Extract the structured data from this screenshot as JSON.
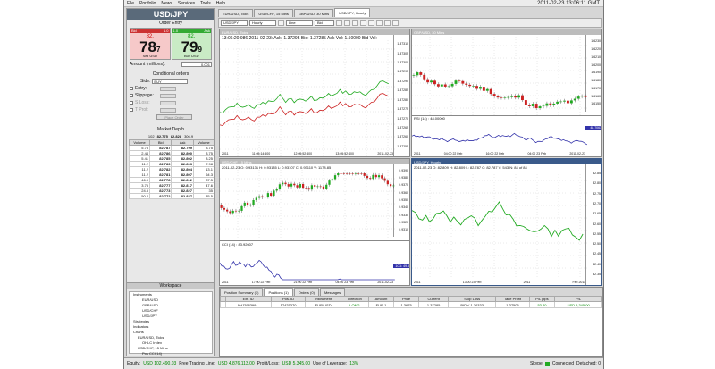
{
  "menu": [
    "File",
    "Portfolio",
    "News",
    "Services",
    "Tools",
    "Help"
  ],
  "clock": "2011-02-23 13:06:11 GMT",
  "order": {
    "symbol": "USD/JPY",
    "subtitle": "Order Entry",
    "bid_label": "Bid",
    "ask_label": "Ask",
    "bid_spread": "1.0",
    "ask_spread": "1.0",
    "bid_small": "82.",
    "ask_small": "82.",
    "bid_big": "78",
    "bid_pip": "7",
    "ask_big": "79",
    "ask_pip": "9",
    "sell_label": "Sell USD",
    "buy_label": "Buy USD",
    "amount_label": "Amount (millions):",
    "amount": "0.001",
    "cond_title": "Conditional orders",
    "side_label": "Side:",
    "side": "BUY",
    "entry": "Entry:",
    "slippage": "Slippage:",
    "sl": "S Loss:",
    "tp": "T Prof:",
    "submit": "Place Order"
  },
  "depth": {
    "title": "Market Depth",
    "summary_left": "102",
    "summary_mid": "82.775",
    "summary_right": "82.828",
    "summary_end": "306.9",
    "headers": [
      "Volume",
      "Bid",
      "Ask",
      "Volume"
    ],
    "rows": [
      [
        "5.75",
        "82.787",
        "82.799",
        "3.75"
      ],
      [
        "2.44",
        "82.786",
        "82.800",
        "3.75"
      ],
      [
        "5.41",
        "82.785",
        "82.802",
        "8.25"
      ],
      [
        "11.2",
        "82.783",
        "82.803",
        "7.98"
      ],
      [
        "11.2",
        "82.782",
        "82.804",
        "13.1"
      ],
      [
        "11.2",
        "82.781",
        "82.807",
        "64.3"
      ],
      [
        "46.9",
        "82.778",
        "82.812",
        "37.5"
      ],
      [
        "3.75",
        "82.777",
        "82.817",
        "47.6"
      ],
      [
        "24.5",
        "82.773",
        "82.827",
        "35"
      ],
      [
        "50.2",
        "82.772",
        "82.837",
        "85.5"
      ]
    ]
  },
  "workspace": {
    "title": "Workspace",
    "items": [
      "Instruments",
      "EUR/USD",
      "GBP/USD",
      "USD/CHF",
      "USD/JPY",
      "Strategies",
      "Indicators",
      "Charts",
      "EUR/USD, Ticks",
      "OHLC Index",
      "USD/CHF, 15 Mins",
      "Pos CCI(14)",
      "OHLC Index"
    ]
  },
  "tabs": [
    "EUR/USD, Ticks",
    "USD/CHF, 15 Mins",
    "GBP/USD, 30 Mins",
    "USD/JPY, Hourly"
  ],
  "toolbar": {
    "pair": "USD/JPY",
    "period": "Hourly",
    "type": "Line",
    "price": "Bid"
  },
  "charts": {
    "c1": {
      "title": "EUR/USD, Ticks",
      "info": "13:06:20.986 2011-02-23: Ask: 1.37295 Bid: 1.37285 Ask Vol: 1.50000 Bid Vol:",
      "axis": [
        "1.37310",
        "1.37305",
        "1.37300",
        "1.37295",
        "1.37290",
        "1.37285",
        "1.37280",
        "1.37275",
        "1.37270",
        "1.37265",
        "1.37260",
        "1.37255"
      ],
      "dates": [
        "2011",
        "11:05:14:400",
        "12:05:52:400",
        "13:05:52:400",
        "2011-02-23"
      ]
    },
    "c2": {
      "title": "GBP/USD, 30 Mins",
      "axis": [
        "1.6230",
        "1.6220",
        "1.6210",
        "1.6200",
        "1.6190",
        "1.6180",
        "1.6170",
        "1.6160",
        "1.6150"
      ],
      "rsi": "RSI (14) : 48.00000",
      "rsi_val": "48.7063",
      "dates": [
        "2011",
        "04:00 22 Feb",
        "16:00 22 Feb",
        "04:00 23 Feb",
        "2011-02-23"
      ]
    },
    "c3": {
      "title": "USD/CHF, 15 Mins",
      "info": "2011-02-23 O: 0.93131 H: 0.93135 L: 0.93107 C: 0.93110 V: 1178.85",
      "axis": [
        "0.9390",
        "0.9380",
        "0.9370",
        "0.9360",
        "0.9350",
        "0.9340",
        "0.9330",
        "0.9320",
        "0.9310"
      ],
      "cci": "CCI (14) : 83.92607",
      "cci_val": "1CA: 49.5 87",
      "dates": [
        "2011",
        "17:00 22 Feb",
        "21:00 22 Feb",
        "04:00 23 Feb",
        "2011-02-23"
      ]
    },
    "c4": {
      "title": "USD/JPY, Hourly",
      "info": "2011-02-23 O: 82.809 H: 82.809 L: 82.787 C: 82.787 V: 543 N: 84 of 84",
      "axis": [
        "82.85",
        "82.80",
        "82.75",
        "82.70",
        "82.65",
        "82.60",
        "82.55",
        "82.50",
        "82.45",
        "82.40",
        "82.35"
      ],
      "dates": [
        "2011",
        "13:00 23 Feb",
        "2011",
        "Feb 2011"
      ]
    }
  },
  "bottom": {
    "tabs": [
      "Position Summary (1)",
      "Positions (1)",
      "Orders (0)",
      "Messages"
    ],
    "headers": [
      "",
      "Ext. ID",
      "Pos. ID",
      "Instrument",
      "Direction",
      "Amount",
      "Price",
      "Current",
      "Stop Loss",
      "Take Profit",
      "P/L pips",
      "P/L"
    ],
    "row": [
      "",
      "AHJ298399...",
      "17425370",
      "EUR/USD",
      "LONG",
      "EUR 1",
      "1.3675",
      "1.37285",
      "BID ≤ 1.36333",
      "1.37506",
      "53.40",
      "USD 5,345.00"
    ]
  },
  "status": {
    "equity_label": "Equity:",
    "equity": "USD 102,490.03",
    "ftl_label": "Free Trading Line:",
    "ftl": "USD 4,876,113.00",
    "pl_label": "Profit/Loss:",
    "pl": "USD 5,345.00",
    "lev_label": "Use of Leverage:",
    "lev": "13%",
    "skype": "Skype",
    "conn": "Connected",
    "detached": "Detached: 0"
  }
}
